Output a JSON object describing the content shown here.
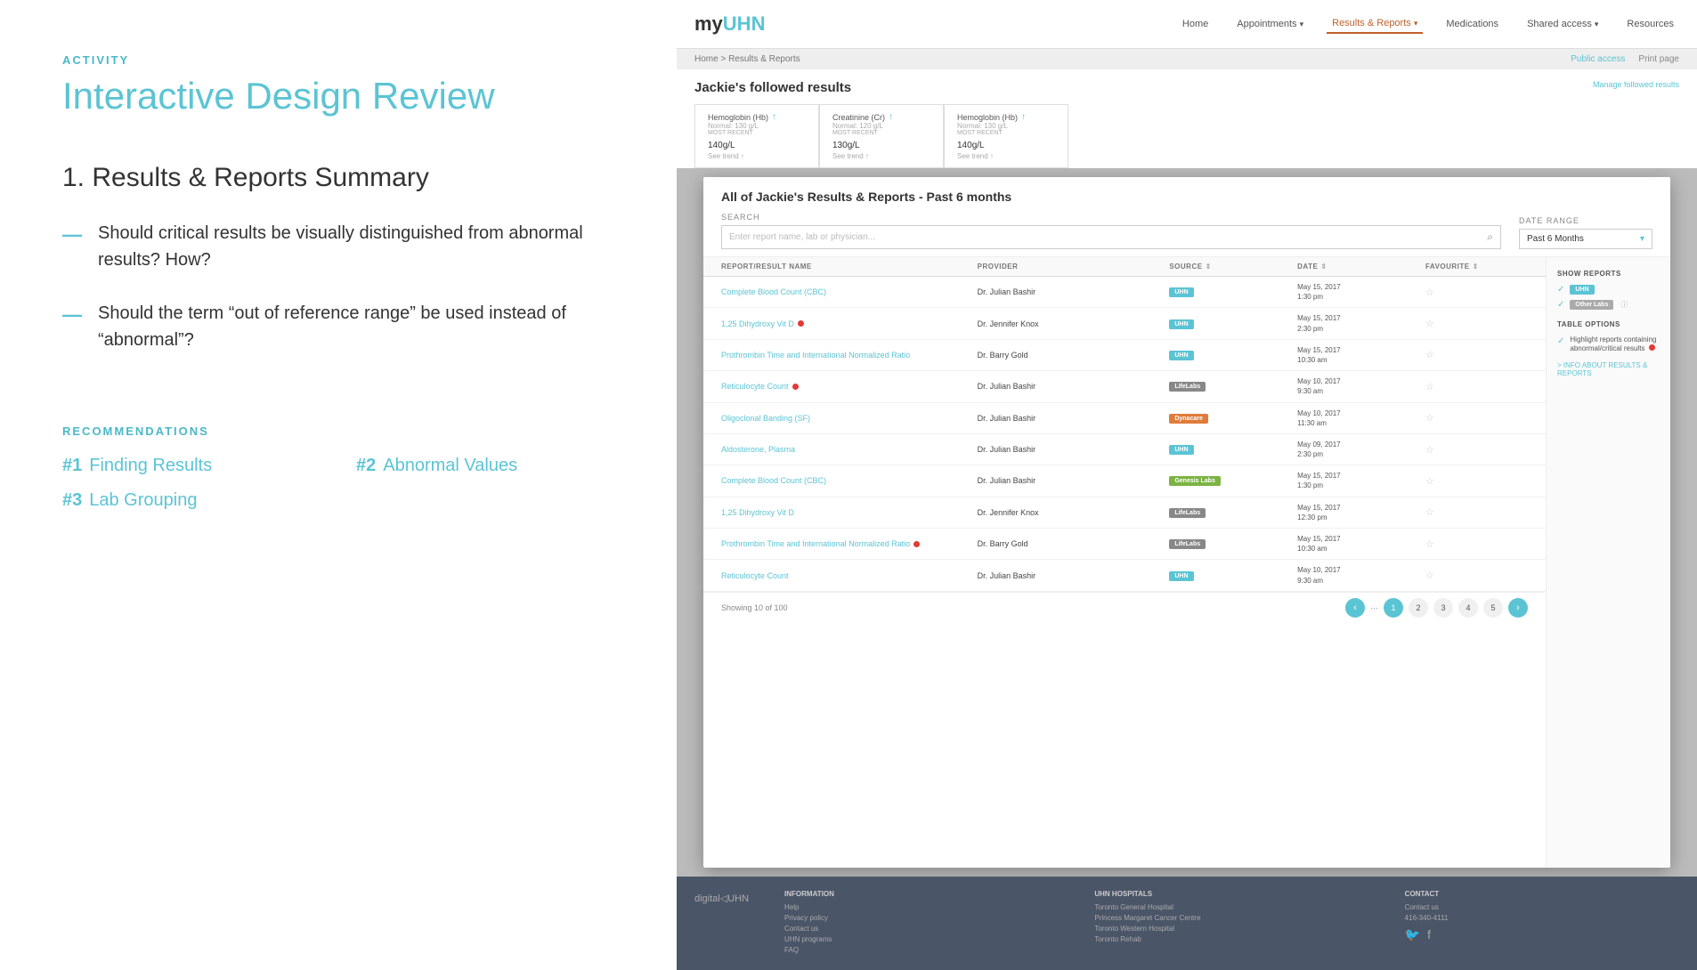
{
  "left": {
    "activity_label": "ACTIVITY",
    "main_title": "Interactive Design Review",
    "section_number": "1.",
    "section_title": "Results & Reports Summary",
    "bullets": [
      {
        "text": "Should critical results be visually distinguished from abnormal results? How?"
      },
      {
        "text": "Should the term “out of reference range” be used instead of “abnormal”?"
      }
    ],
    "recommendations_label": "RECOMMENDATIONS",
    "recommendations": [
      {
        "num": "#1",
        "text": "Finding Results"
      },
      {
        "num": "#2",
        "text": "Abnormal Values"
      },
      {
        "num": "#3",
        "text": "Lab Grouping"
      }
    ]
  },
  "app": {
    "logo_my": "my",
    "logo_uhn": "UHN",
    "nav_items": [
      {
        "label": "Home",
        "active": false
      },
      {
        "label": "Appointments ▾",
        "active": false
      },
      {
        "label": "Results & Reports ▾",
        "active": true
      },
      {
        "label": "Medications",
        "active": false
      },
      {
        "label": "Shared access ▾",
        "active": false
      },
      {
        "label": "Resources",
        "active": false
      }
    ],
    "breadcrumb": "Home > Results & Reports",
    "breadcrumb_actions": [
      "Public access",
      "Print page"
    ],
    "followed_title": "Jackie's followed results",
    "manage_link": "Manage followed results",
    "result_cards": [
      {
        "title": "Hemoglobin (Hb)",
        "normal": "Normal: 130 g/L",
        "most_recent_label": "MOST RECENT",
        "value": "140",
        "unit": "g/L",
        "sub": "See trend ↑"
      },
      {
        "title": "Creatinine (Cr)",
        "normal": "Normal: 120 g/L",
        "most_recent_label": "MOST RECENT",
        "value": "130",
        "unit": "g/L",
        "sub": "See trend ↑"
      },
      {
        "title": "Hemoglobin (Hb)",
        "normal": "Normal: 130 g/L",
        "most_recent_label": "MOST RECENT",
        "value": "140",
        "unit": "g/L",
        "sub": "See trend ↑"
      }
    ],
    "modal": {
      "title": "All of Jackie's Results & Reports - Past 6 months",
      "search_label": "SEARCH",
      "search_placeholder": "Enter report name, lab or physician...",
      "date_label": "DATE RANGE",
      "date_value": "Past 6 Months",
      "columns": [
        {
          "label": "REPORT/RESULT NAME"
        },
        {
          "label": "PROVIDER"
        },
        {
          "label": "SOURCE"
        },
        {
          "label": "DATE"
        },
        {
          "label": "FAVOURITE"
        }
      ],
      "rows": [
        {
          "name": "Complete Blood Count (CBC)",
          "provider": "Dr. Julian Bashir",
          "badge": "UHN",
          "badge_type": "uhn",
          "date": "May 15, 2017",
          "time": "1:30 pm",
          "critical": false
        },
        {
          "name": "1,25 Dihydroxy Vit D",
          "provider": "Dr. Jennifer Knox",
          "badge": "UHN",
          "badge_type": "uhn",
          "date": "May 15, 2017",
          "time": "2:30 pm",
          "critical": true
        },
        {
          "name": "Prothrombin Time and International Normalized Ratio",
          "provider": "Dr. Barry Gold",
          "badge": "UHN",
          "badge_type": "uhn",
          "date": "May 15, 2017",
          "time": "10:30 am",
          "critical": false
        },
        {
          "name": "Reticulocyte Count",
          "provider": "Dr. Julian Bashir",
          "badge": "LifeLabs",
          "badge_type": "lifelabs",
          "date": "May 10, 2017",
          "time": "9:30 am",
          "critical": true
        },
        {
          "name": "Oligoclonal Banding (SF)",
          "provider": "Dr. Julian Bashir",
          "badge": "Dynacare",
          "badge_type": "dynacare",
          "date": "May 10, 2017",
          "time": "11:30 am",
          "critical": false
        },
        {
          "name": "Aldosterone, Plasma",
          "provider": "Dr. Julian Bashir",
          "badge": "UHN",
          "badge_type": "uhn",
          "date": "May 09, 2017",
          "time": "2:30 pm",
          "critical": false
        },
        {
          "name": "Complete Blood Count (CBC)",
          "provider": "Dr. Julian Bashir",
          "badge": "Genesis Labs",
          "badge_type": "genesis",
          "date": "May 15, 2017",
          "time": "1:30 pm",
          "critical": false
        },
        {
          "name": "1,25 Dihydroxy Vit D",
          "provider": "Dr. Jennifer Knox",
          "badge": "LifeLabs",
          "badge_type": "lifelabs",
          "date": "May 15, 2017",
          "time": "12:30 pm",
          "critical": false
        },
        {
          "name": "Prothrombin Time and International Normalized Ratio",
          "provider": "Dr. Barry Gold",
          "badge": "LifeLabs",
          "badge_type": "lifelabs",
          "date": "May 15, 2017",
          "time": "10:30 am",
          "critical": true
        },
        {
          "name": "Reticulocyte Count",
          "provider": "Dr. Julian Bashir",
          "badge": "UHN",
          "badge_type": "uhn",
          "date": "May 10, 2017",
          "time": "9:30 am",
          "critical": false
        }
      ],
      "showing_text": "Showing 10 of 100",
      "pages": [
        "1",
        "2",
        "3",
        "4",
        "5"
      ],
      "sidebar": {
        "show_reports_title": "SHOW REPORTS",
        "show_reports": [
          {
            "label": "UHN",
            "checked": true,
            "type": "uhn"
          },
          {
            "label": "Other Labs",
            "checked": true,
            "type": "other"
          }
        ],
        "table_options_title": "TABLE OPTIONS",
        "table_option": "Highlight reports containing abnormal/critical results",
        "info_link": "> INFO ABOUT RESULTS & REPORTS"
      }
    },
    "footer": {
      "logo": "digital◁UHN",
      "columns": [
        {
          "title": "INFORMATION",
          "links": [
            "Help",
            "Privacy policy",
            "Contact us",
            "UHN programs",
            "FAQ"
          ]
        },
        {
          "title": "UHN HOSPITALS",
          "links": [
            "Toronto General Hospital",
            "Princess Margaret Cancer Centre",
            "Toronto Western Hospital",
            "Toronto Rehab"
          ]
        },
        {
          "title": "CONTACT",
          "links": [
            "Contact us",
            "416-340-4111"
          ]
        }
      ]
    }
  }
}
